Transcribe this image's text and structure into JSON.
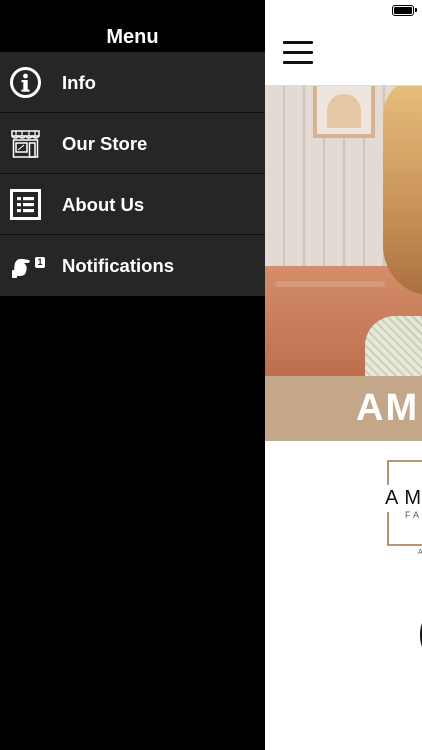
{
  "drawer": {
    "title": "Menu",
    "items": [
      {
        "label": "Info",
        "icon": "info-icon"
      },
      {
        "label": "Our Store",
        "icon": "store-icon"
      },
      {
        "label": "About Us",
        "icon": "list-icon"
      },
      {
        "label": "Notifications",
        "icon": "notification-icon",
        "badge": "1"
      }
    ]
  },
  "main": {
    "brand_text": "AM",
    "logo_text": "AM",
    "logo_sub": "FAS",
    "logo_mark": "A"
  },
  "colors": {
    "drawer_bg": "#000000",
    "menu_item_bg": "#262626",
    "brand_band": "#c4a788",
    "logo_border": "#b99470"
  }
}
